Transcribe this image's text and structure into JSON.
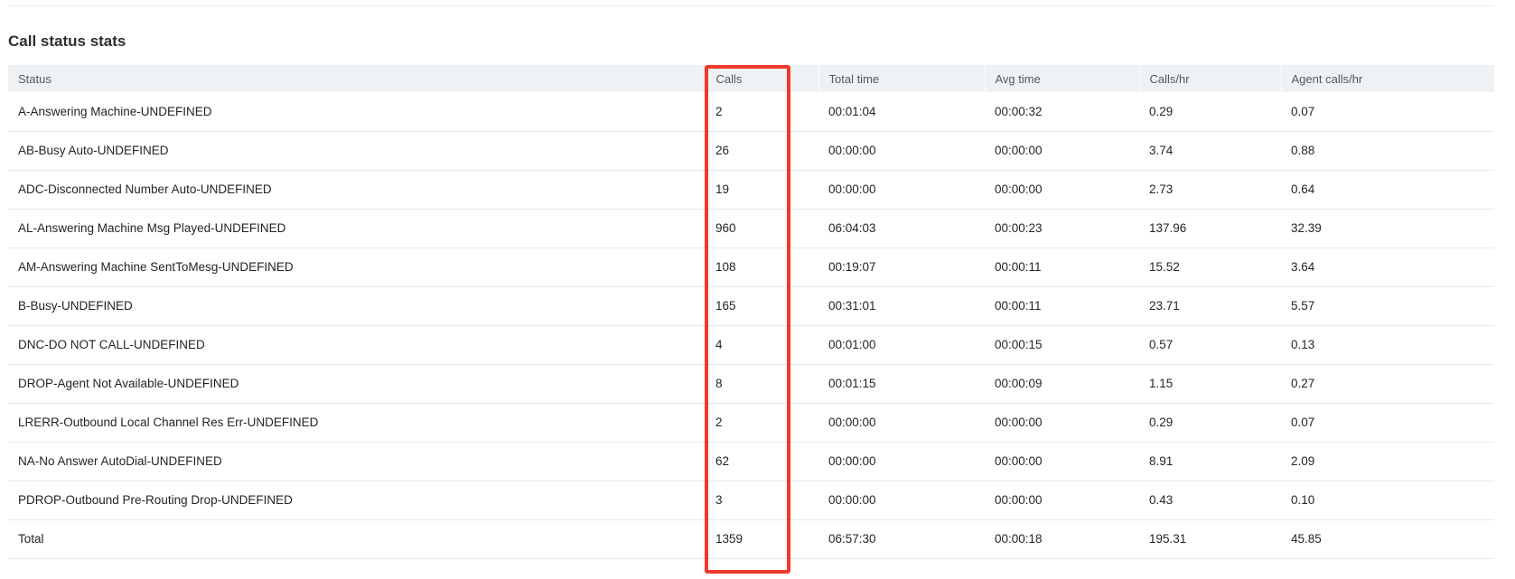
{
  "section": {
    "title": "Call status stats"
  },
  "table": {
    "headers": {
      "status": "Status",
      "calls": "Calls",
      "total_time": "Total time",
      "avg_time": "Avg time",
      "calls_per_hr": "Calls/hr",
      "agent_calls_per_hr": "Agent calls/hr"
    },
    "rows": [
      {
        "status": "A-Answering Machine-UNDEFINED",
        "calls": "2",
        "total_time": "00:01:04",
        "avg_time": "00:00:32",
        "calls_per_hr": "0.29",
        "agent_calls_per_hr": "0.07"
      },
      {
        "status": "AB-Busy Auto-UNDEFINED",
        "calls": "26",
        "total_time": "00:00:00",
        "avg_time": "00:00:00",
        "calls_per_hr": "3.74",
        "agent_calls_per_hr": "0.88"
      },
      {
        "status": "ADC-Disconnected Number Auto-UNDEFINED",
        "calls": "19",
        "total_time": "00:00:00",
        "avg_time": "00:00:00",
        "calls_per_hr": "2.73",
        "agent_calls_per_hr": "0.64"
      },
      {
        "status": "AL-Answering Machine Msg Played-UNDEFINED",
        "calls": "960",
        "total_time": "06:04:03",
        "avg_time": "00:00:23",
        "calls_per_hr": "137.96",
        "agent_calls_per_hr": "32.39"
      },
      {
        "status": "AM-Answering Machine SentToMesg-UNDEFINED",
        "calls": "108",
        "total_time": "00:19:07",
        "avg_time": "00:00:11",
        "calls_per_hr": "15.52",
        "agent_calls_per_hr": "3.64"
      },
      {
        "status": "B-Busy-UNDEFINED",
        "calls": "165",
        "total_time": "00:31:01",
        "avg_time": "00:00:11",
        "calls_per_hr": "23.71",
        "agent_calls_per_hr": "5.57"
      },
      {
        "status": "DNC-DO NOT CALL-UNDEFINED",
        "calls": "4",
        "total_time": "00:01:00",
        "avg_time": "00:00:15",
        "calls_per_hr": "0.57",
        "agent_calls_per_hr": "0.13"
      },
      {
        "status": "DROP-Agent Not Available-UNDEFINED",
        "calls": "8",
        "total_time": "00:01:15",
        "avg_time": "00:00:09",
        "calls_per_hr": "1.15",
        "agent_calls_per_hr": "0.27"
      },
      {
        "status": "LRERR-Outbound Local Channel Res Err-UNDEFINED",
        "calls": "2",
        "total_time": "00:00:00",
        "avg_time": "00:00:00",
        "calls_per_hr": "0.29",
        "agent_calls_per_hr": "0.07"
      },
      {
        "status": "NA-No Answer AutoDial-UNDEFINED",
        "calls": "62",
        "total_time": "00:00:00",
        "avg_time": "00:00:00",
        "calls_per_hr": "8.91",
        "agent_calls_per_hr": "2.09"
      },
      {
        "status": "PDROP-Outbound Pre-Routing Drop-UNDEFINED",
        "calls": "3",
        "total_time": "00:00:00",
        "avg_time": "00:00:00",
        "calls_per_hr": "0.43",
        "agent_calls_per_hr": "0.10"
      },
      {
        "status": "Total",
        "calls": "1359",
        "total_time": "06:57:30",
        "avg_time": "00:00:18",
        "calls_per_hr": "195.31",
        "agent_calls_per_hr": "45.85"
      }
    ]
  },
  "colors": {
    "header_bg": "#eff2f5",
    "row_border": "#e6e8eb",
    "highlight": "#f1392a"
  }
}
